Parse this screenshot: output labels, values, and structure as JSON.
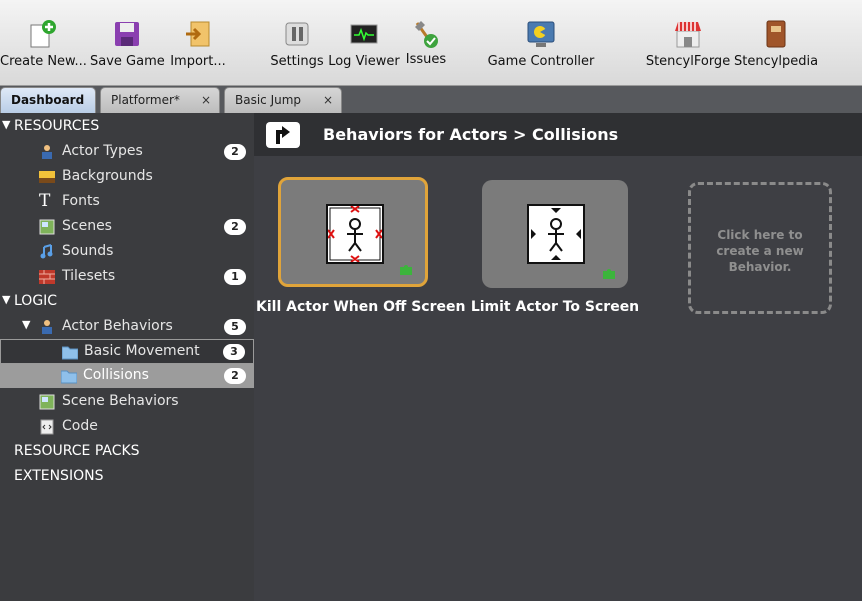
{
  "toolbar": {
    "items": [
      {
        "label": "Create New...",
        "icon": "create-new-icon"
      },
      {
        "label": "Save Game",
        "icon": "save-icon"
      },
      {
        "label": "Import...",
        "icon": "import-icon"
      },
      {
        "label": "Settings",
        "icon": "settings-icon"
      },
      {
        "label": "Log Viewer",
        "icon": "log-viewer-icon"
      },
      {
        "label": "Issues",
        "icon": "issues-icon"
      },
      {
        "label": "Game Controller",
        "icon": "game-controller-icon"
      },
      {
        "label": "StencylForge",
        "icon": "stencylforge-icon"
      },
      {
        "label": "Stencylpedia",
        "icon": "stencylpedia-icon"
      }
    ]
  },
  "tabs": [
    {
      "label": "Dashboard",
      "active": true
    },
    {
      "label": "Platformer*",
      "close": "×"
    },
    {
      "label": "Basic Jump",
      "close": "×"
    }
  ],
  "sidebar": {
    "resources_header": "RESOURCES",
    "resources": [
      {
        "label": "Actor Types",
        "badge": "2",
        "icon": "actor-icon"
      },
      {
        "label": "Backgrounds",
        "icon": "background-icon"
      },
      {
        "label": "Fonts",
        "icon": "font-icon"
      },
      {
        "label": "Scenes",
        "badge": "2",
        "icon": "scene-icon"
      },
      {
        "label": "Sounds",
        "icon": "sound-icon"
      },
      {
        "label": "Tilesets",
        "badge": "1",
        "icon": "tileset-icon"
      }
    ],
    "logic_header": "LOGIC",
    "actor_behaviors": {
      "label": "Actor Behaviors",
      "badge": "5"
    },
    "basic_movement": {
      "label": "Basic Movement",
      "badge": "3"
    },
    "collisions": {
      "label": "Collisions",
      "badge": "2"
    },
    "scene_behaviors": {
      "label": "Scene Behaviors"
    },
    "code": {
      "label": "Code"
    },
    "resource_packs": "RESOURCE PACKS",
    "extensions": "EXTENSIONS"
  },
  "main": {
    "title": "Behaviors for Actors > Collisions",
    "cards": [
      {
        "label": "Kill Actor When Off Screen"
      },
      {
        "label": "Limit Actor To Screen"
      }
    ],
    "new_behavior": "Click here to create a new Behavior."
  },
  "colors": {
    "selected_card_border": "#e0a43a",
    "active_tab": "#c8d8ee"
  }
}
